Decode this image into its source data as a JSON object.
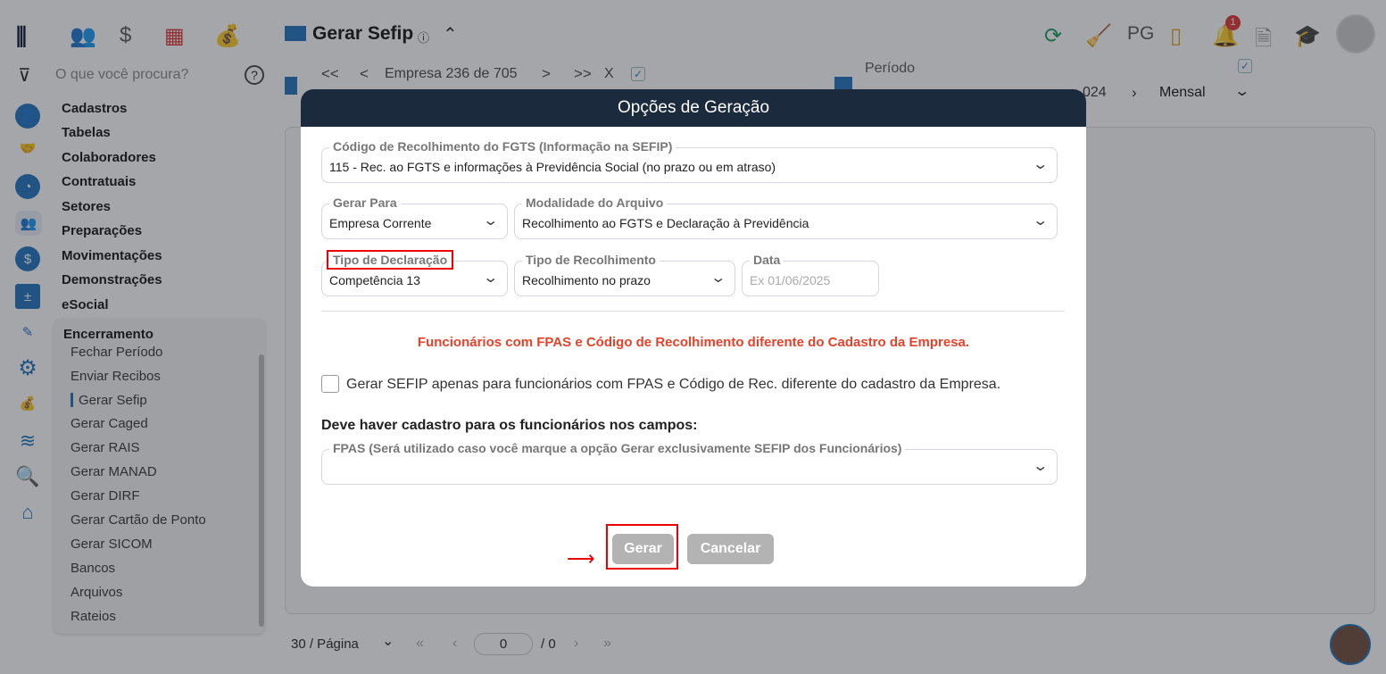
{
  "header": {
    "title": "Gerar Sefip",
    "pg": "PG",
    "notification_count": "1"
  },
  "search": {
    "placeholder": "O que você procura?"
  },
  "nav": {
    "first": "<<",
    "prev": "<",
    "company": "Empresa 236 de 705",
    "next": ">",
    "last": ">>",
    "close": "X"
  },
  "period": {
    "label": "Período",
    "value_visible": "024",
    "type": "Mensal"
  },
  "sidebar": {
    "items": [
      "Cadastros",
      "Tabelas",
      "Colaboradores",
      "Contratuais",
      "Setores",
      "Preparações",
      "Movimentações",
      "Demonstrações",
      "eSocial"
    ],
    "submenu_title": "Encerramento",
    "subitems": [
      "Fechar Período",
      "Enviar Recibos",
      "Gerar Sefip",
      "Gerar Caged",
      "Gerar RAIS",
      "Gerar MANAD",
      "Gerar DIRF",
      "Gerar Cartão de Ponto",
      "Gerar SICOM",
      "Bancos",
      "Arquivos",
      "Rateios"
    ]
  },
  "pagination": {
    "per_page": "30 / Página",
    "page": "0",
    "total": "/ 0"
  },
  "modal": {
    "title": "Opções de Geração",
    "codigo": {
      "label": "Código de Recolhimento do FGTS (Informação na SEFIP)",
      "value": "115 - Rec. ao FGTS e informações à Previdência Social (no prazo ou em atraso)"
    },
    "gerar_para": {
      "label": "Gerar Para",
      "value": "Empresa Corrente"
    },
    "modalidade": {
      "label": "Modalidade do Arquivo",
      "value": "Recolhimento ao FGTS e Declaração à Previdência"
    },
    "tipo_declaracao": {
      "label": "Tipo de Declaração",
      "value": "Competência 13"
    },
    "tipo_recolhimento": {
      "label": "Tipo de Recolhimento",
      "value": "Recolhimento no prazo"
    },
    "data": {
      "label": "Data",
      "placeholder": "Ex 01/06/2025"
    },
    "warning": "Funcionários com FPAS e Código de Recolhimento diferente do Cadastro da Empresa.",
    "checkbox_label": "Gerar SEFIP apenas para funcionários com FPAS e Código de Rec. diferente do cadastro da Empresa.",
    "section_title": "Deve haver cadastro para os funcionários nos campos:",
    "fpas": {
      "label": "FPAS (Será utilizado caso você marque a opção Gerar exclusivamente SEFIP dos Funcionários)",
      "value": ""
    },
    "gerar": "Gerar",
    "cancelar": "Cancelar"
  }
}
